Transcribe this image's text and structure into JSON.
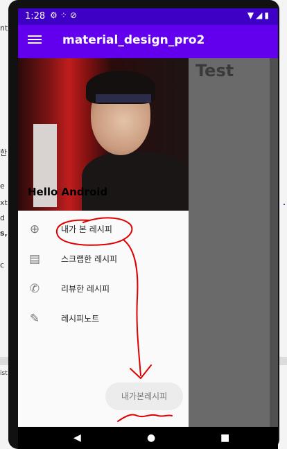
{
  "background": {
    "left_fragments": [
      "nt",
      "한",
      "e",
      "xt",
      "d",
      "s,",
      "c",
      "ist"
    ],
    "right_fragments": [
      "."
    ]
  },
  "status_bar": {
    "time": "1:28",
    "left_icons": [
      "gear-icon",
      "dots-icon",
      "sync-icon"
    ],
    "right_icons": [
      "wifi-icon",
      "signal-icon",
      "battery-icon"
    ]
  },
  "app_bar": {
    "title": "material_design_pro2",
    "menu_icon": "hamburger-icon"
  },
  "content": {
    "heading": "Test"
  },
  "drawer": {
    "header_text": "Hello Android",
    "items": [
      {
        "label": "내가 본 레시피",
        "icon": "add-circle-icon"
      },
      {
        "label": "스크랩한 레시피",
        "icon": "clipboard-icon"
      },
      {
        "label": "리뷰한 레시피",
        "icon": "phone-icon"
      },
      {
        "label": "레시피노트",
        "icon": "pencil-icon"
      }
    ]
  },
  "chip": {
    "label": "내가본레시피"
  },
  "colors": {
    "status_bar": "#3e00c4",
    "app_bar": "#6200ee",
    "annotation": "#e00000"
  }
}
